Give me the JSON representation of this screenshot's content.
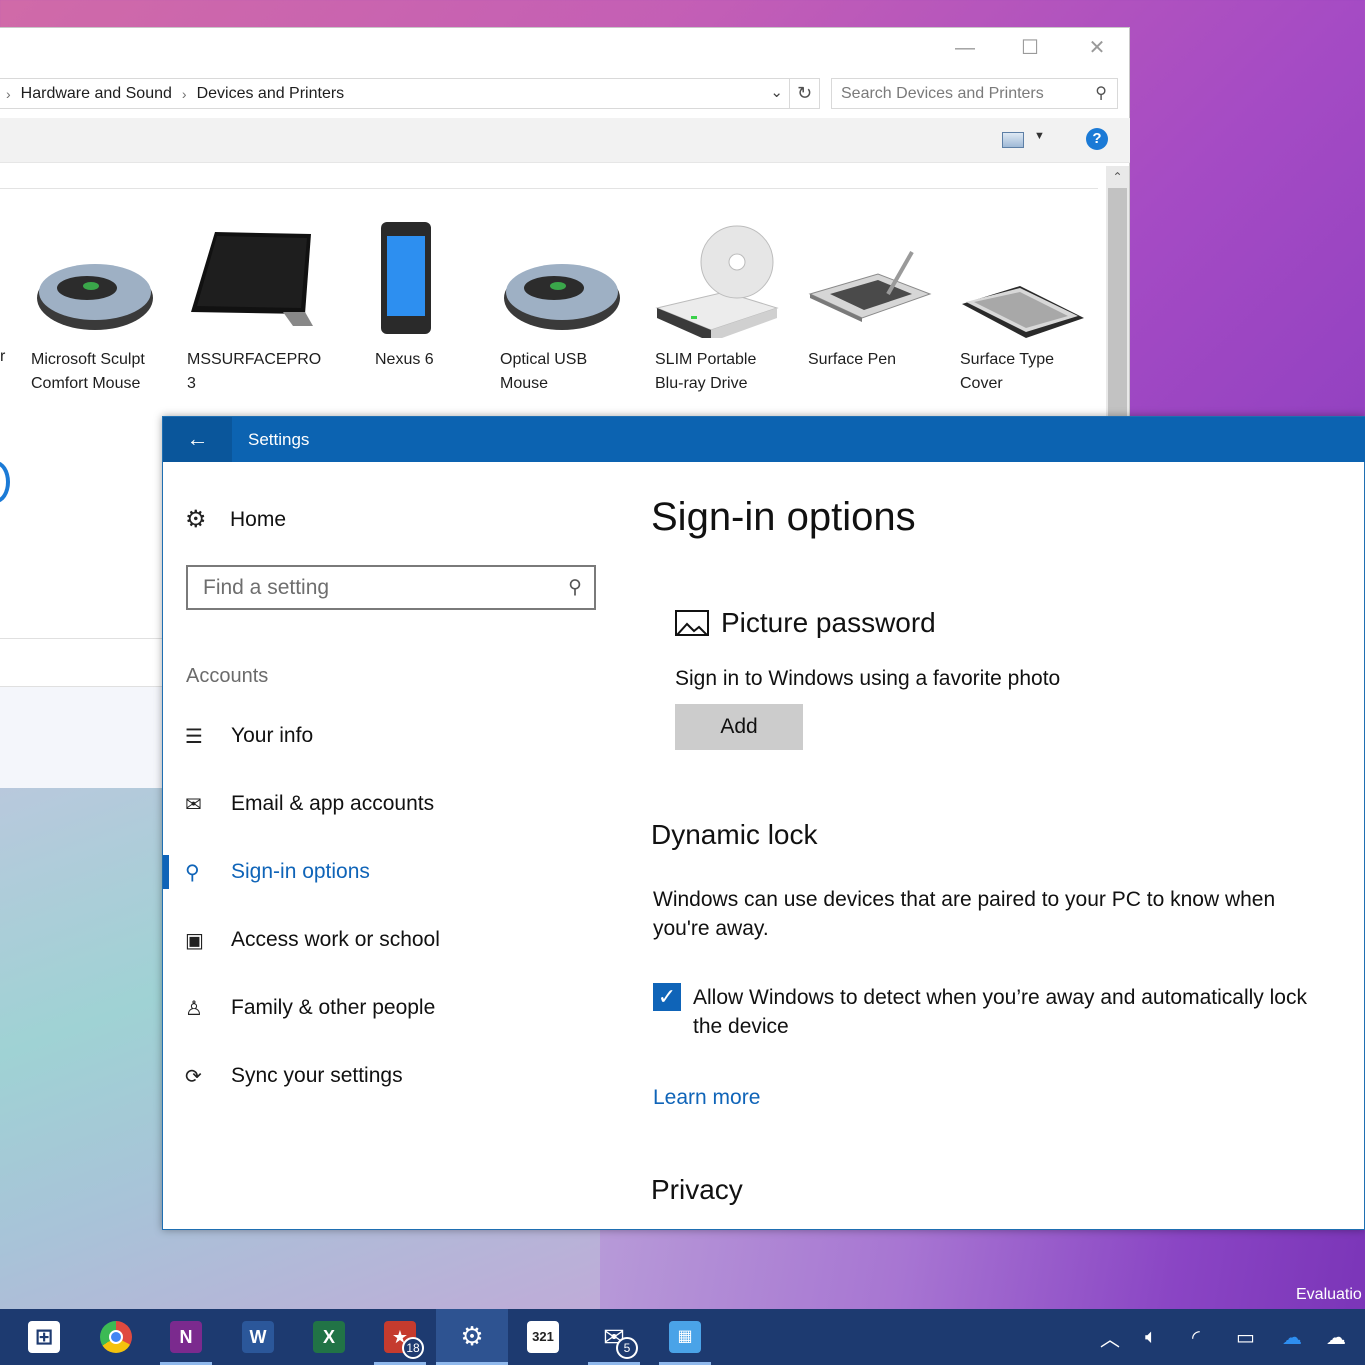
{
  "explorer": {
    "breadcrumb": [
      "Hardware and Sound",
      "Devices and Printers"
    ],
    "search_placeholder": "Search Devices and Printers",
    "help_label": "?",
    "devices": [
      {
        "label": "Microsoft Sculpt\nComfort Mouse",
        "icon": "mouse-icon"
      },
      {
        "label": "MSSURFACEPRO\n3",
        "icon": "tablet-icon"
      },
      {
        "label": "Nexus 6",
        "icon": "phone-icon"
      },
      {
        "label": "Optical USB\nMouse",
        "icon": "mouse-icon"
      },
      {
        "label": "SLIM Portable\nBlu-ray Drive",
        "icon": "optical-drive-icon"
      },
      {
        "label": "Surface Pen",
        "icon": "pen-tablet-icon"
      },
      {
        "label": "Surface Type\nCover",
        "icon": "keyboard-icon"
      }
    ],
    "partial_left_label": "r"
  },
  "settings": {
    "window_title": "Settings",
    "nav": {
      "home": "Home",
      "search_placeholder": "Find a setting",
      "section": "Accounts",
      "items": [
        {
          "label": "Your info",
          "icon": "person-list-icon",
          "active": false
        },
        {
          "label": "Email & app accounts",
          "icon": "mail-icon",
          "active": false
        },
        {
          "label": "Sign-in options",
          "icon": "key-icon",
          "active": true
        },
        {
          "label": "Access work or school",
          "icon": "briefcase-icon",
          "active": false
        },
        {
          "label": "Family & other people",
          "icon": "add-person-icon",
          "active": false
        },
        {
          "label": "Sync your settings",
          "icon": "sync-icon",
          "active": false
        }
      ]
    },
    "content": {
      "title": "Sign-in options",
      "picture_password": {
        "heading": "Picture password",
        "description": "Sign in to Windows using a favorite photo",
        "button": "Add"
      },
      "dynamic_lock": {
        "heading": "Dynamic lock",
        "description": "Windows can use devices that are paired to your PC to know when you're away.",
        "checkbox_label": "Allow Windows to detect when you’re away and automatically lock the device",
        "checked": true,
        "link": "Learn more"
      },
      "privacy_heading": "Privacy"
    }
  },
  "watermark": "Evaluatio",
  "taskbar": {
    "apps": [
      {
        "name": "start",
        "glyph": "⊞",
        "color": "#1d3a70"
      },
      {
        "name": "chrome",
        "glyph": "●",
        "color": "#e04a3f"
      },
      {
        "name": "onenote",
        "glyph": "N",
        "color": "#7b2a8e"
      },
      {
        "name": "word",
        "glyph": "W",
        "color": "#2b579a"
      },
      {
        "name": "excel",
        "glyph": "X",
        "color": "#217346"
      },
      {
        "name": "wunderlist",
        "glyph": "★",
        "color": "#c53b2e",
        "badge": "18"
      },
      {
        "name": "settings",
        "glyph": "⚙",
        "color": "#2e5391",
        "active": true
      },
      {
        "name": "calendar",
        "glyph": "321",
        "color": "#ffffff"
      },
      {
        "name": "mail",
        "glyph": "✉",
        "color": "#1d3a70",
        "badge": "5"
      },
      {
        "name": "control-panel",
        "glyph": "▦",
        "color": "#4aa3e8"
      }
    ],
    "tray": [
      "chevron-up-icon",
      "speaker-icon",
      "wifi-icon",
      "battery-icon",
      "onedrive-icon",
      "onedrive-personal-icon"
    ]
  }
}
